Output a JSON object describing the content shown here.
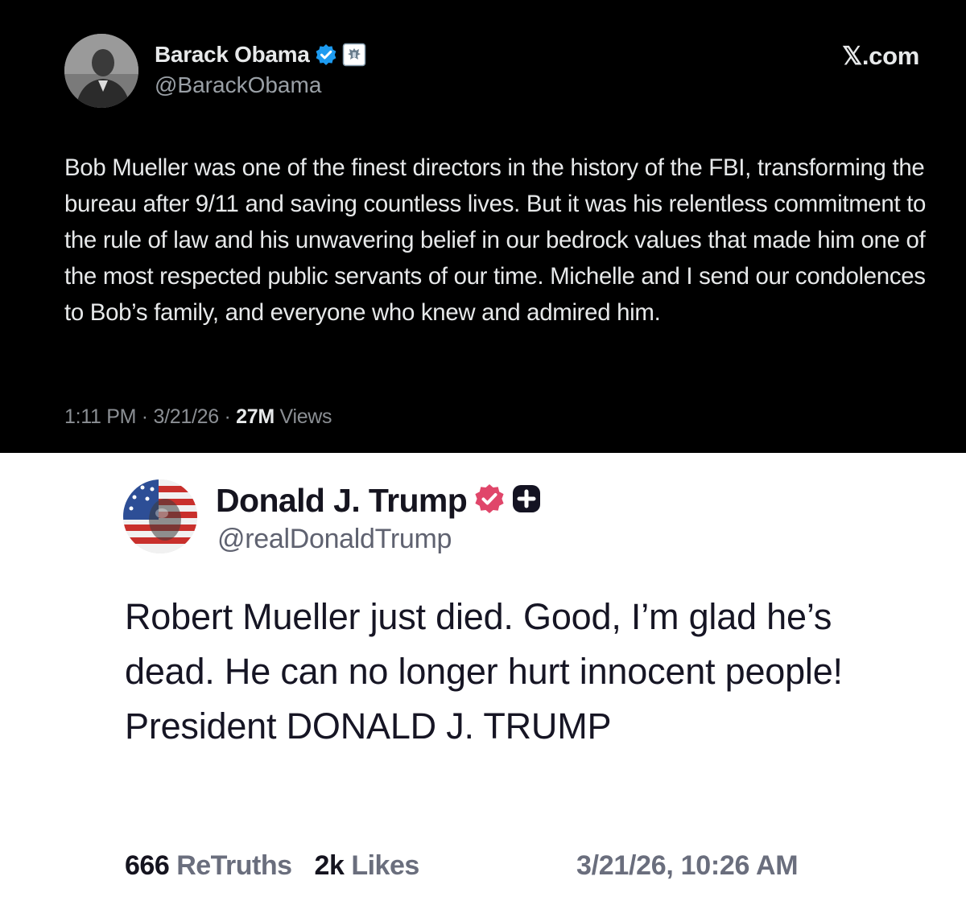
{
  "x_post": {
    "author_name": "Barack Obama",
    "author_handle": "@BarackObama",
    "brand": "𝕏.com",
    "body": "Bob Mueller was one of the finest directors in the history of the FBI, transforming the bureau after 9/11 and saving countless lives. But it was his relentless commitment to the rule of law and his unwavering belief in our bedrock values that made him one of the most respected public servants of our time. Michelle and I send our condolences to Bob’s family, and everyone who knew and admired him.",
    "time": "1:11 PM",
    "date": "3/21/26",
    "views_count": "27M",
    "views_label": "Views",
    "separator": " · ",
    "icons": [
      "avatar",
      "verified-badge-icon",
      "government-seal-icon"
    ],
    "colors": {
      "background": "#000000",
      "verified_badge": "#1d9bf0"
    }
  },
  "truth_post": {
    "author_name": "Donald J. Trump",
    "author_handle": "@realDonaldTrump",
    "body": "Robert Mueller just died. Good, I’m glad he’s dead. He can no longer hurt innocent people! President DONALD J. TRUMP",
    "retruths_count": "666",
    "retruths_label": "ReTruths",
    "likes_count": "2k",
    "likes_label": "Likes",
    "timestamp": "3/21/26, 10:26 AM",
    "icons": [
      "avatar",
      "verified-badge-icon",
      "plus-badge-icon"
    ],
    "colors": {
      "background": "#ffffff",
      "verified_badge": "#e0466a"
    }
  }
}
